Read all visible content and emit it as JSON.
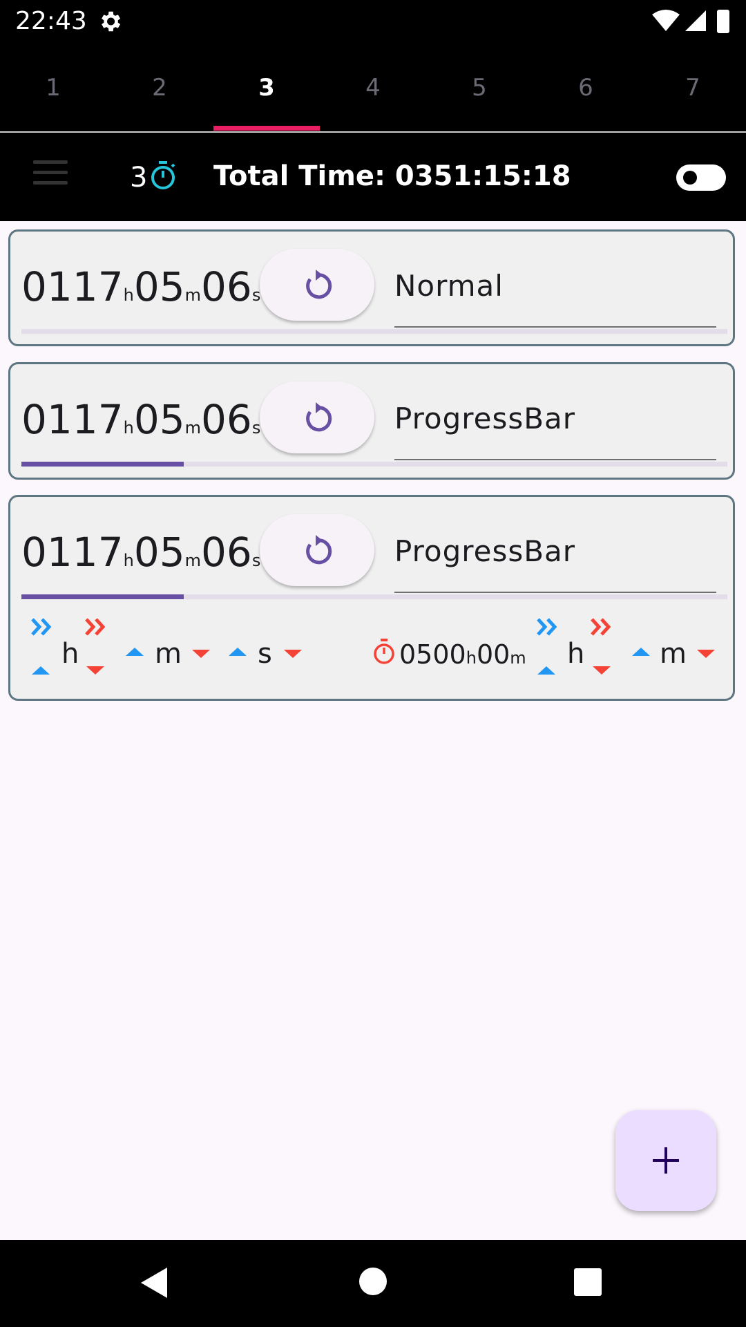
{
  "status_bar": {
    "time": "22:43",
    "icons": [
      "gear-icon",
      "wifi-icon",
      "signal-icon",
      "battery-icon"
    ]
  },
  "tabs": [
    {
      "label": "1",
      "active": false
    },
    {
      "label": "2",
      "active": false
    },
    {
      "label": "3",
      "active": true
    },
    {
      "label": "4",
      "active": false
    },
    {
      "label": "5",
      "active": false
    },
    {
      "label": "6",
      "active": false
    },
    {
      "label": "7",
      "active": false
    }
  ],
  "header": {
    "timer_count": "3",
    "total_time": "Total Time: 0351:15:18",
    "toggle_on": false
  },
  "timers": [
    {
      "hours": "0117",
      "minutes": "05",
      "seconds": "06",
      "h_unit": "h",
      "m_unit": "m",
      "s_unit": "s",
      "label": "Normal",
      "progress": 0
    },
    {
      "hours": "0117",
      "minutes": "05",
      "seconds": "06",
      "h_unit": "h",
      "m_unit": "m",
      "s_unit": "s",
      "label": "ProgressBar",
      "progress": 0.23
    },
    {
      "hours": "0117",
      "minutes": "05",
      "seconds": "06",
      "h_unit": "h",
      "m_unit": "m",
      "s_unit": "s",
      "label": "ProgressBar",
      "progress": 0.23
    }
  ],
  "controls": {
    "h": "h",
    "m": "m",
    "s": "s",
    "target_hours": "0500",
    "target_h_unit": "h",
    "target_minutes": "00",
    "target_m_unit": "m",
    "target_h": "h",
    "target_m": "m"
  },
  "colors": {
    "accent": "#6750a4",
    "tab_indicator": "#e91e63",
    "up": "#2196f3",
    "down": "#f44336",
    "stopwatch": "#26c6da"
  }
}
